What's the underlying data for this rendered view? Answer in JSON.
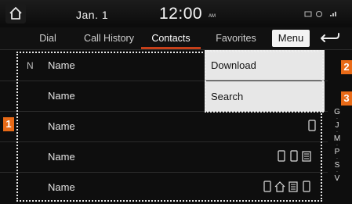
{
  "statusbar": {
    "date": "Jan.  1",
    "time": "12:00",
    "ampm": "AM"
  },
  "tabs": [
    {
      "label": "Dial"
    },
    {
      "label": "Call History"
    },
    {
      "label": "Contacts"
    },
    {
      "label": "Favorites"
    }
  ],
  "active_tab": "Contacts",
  "menu_label": "Menu",
  "menu_items": [
    {
      "label": "Download"
    },
    {
      "label": "Search"
    }
  ],
  "contacts": [
    {
      "letter": "N",
      "name": "Name",
      "icons": []
    },
    {
      "letter": "",
      "name": "Name",
      "icons": []
    },
    {
      "letter": "",
      "name": "Name",
      "icons": [
        "mobile"
      ]
    },
    {
      "letter": "",
      "name": "Name",
      "icons": [
        "mobile",
        "mobile",
        "office"
      ]
    },
    {
      "letter": "",
      "name": "Name",
      "icons": [
        "mobile",
        "home",
        "office",
        "mobile"
      ]
    }
  ],
  "index_letters": [
    "G",
    "J",
    "M",
    "P",
    "S",
    "V"
  ],
  "callouts": [
    "1",
    "2",
    "3"
  ],
  "colors": {
    "accent": "#c6401a",
    "callout": "#e86a17",
    "menu_bg": "#e7e7e7"
  }
}
